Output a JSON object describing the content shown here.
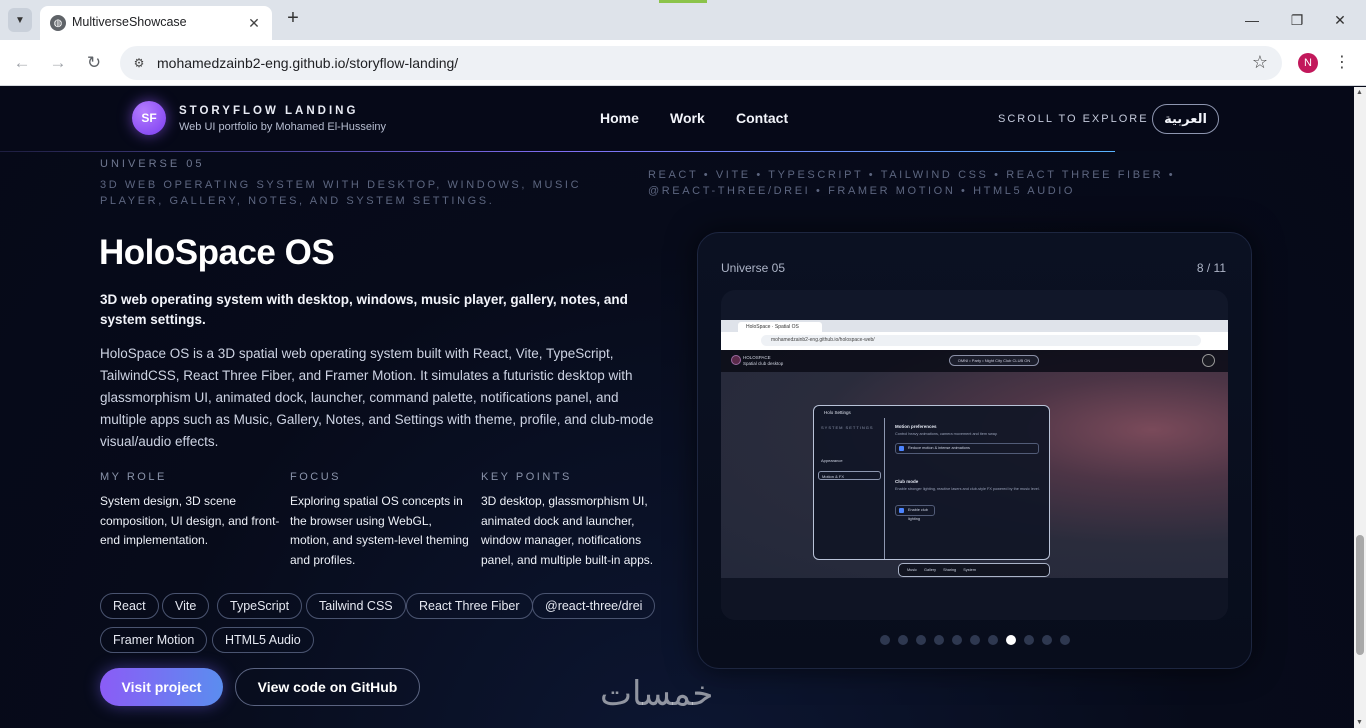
{
  "browser": {
    "tab_title": "MultiverseShowcase",
    "url": "mohamedzainb2-eng.github.io/storyflow-landing/",
    "profile_initial": "N",
    "icons": {
      "tab_list": "chevron-down-icon",
      "favicon": "globe-icon",
      "close_tab": "close-icon",
      "new_tab": "plus-icon",
      "back": "back-arrow-icon",
      "forward": "forward-arrow-icon",
      "reload": "reload-icon",
      "site_info": "site-info-icon",
      "bookmark": "star-icon",
      "menu": "kebab-menu-icon",
      "minimize": "minimize-icon",
      "maximize": "restore-icon",
      "close_window": "close-icon"
    }
  },
  "header": {
    "logo_initials": "SF",
    "brand_title": "STORYFLOW LANDING",
    "brand_subtitle": "Web UI portfolio by Mohamed El-Husseiny",
    "nav": [
      "Home",
      "Work",
      "Contact"
    ],
    "scroll_hint": "SCROLL TO EXPLORE",
    "language_button": "العربية"
  },
  "project": {
    "universe_label": "UNIVERSE 05",
    "universe_description": "3D web operating system with desktop, windows, music player, gallery, notes, and system settings.",
    "stack_line": "React • Vite • TypeScript • Tailwind CSS • React Three Fiber • @react-three/drei • Framer Motion • HTML5 Audio",
    "title": "HoloSpace OS",
    "tagline": "3D web operating system with desktop, windows, music player, gallery, notes, and system settings.",
    "description": "HoloSpace OS is a 3D spatial web operating system built with React, Vite, TypeScript, TailwindCSS, React Three Fiber, and Framer Motion. It simulates a futuristic desktop with glassmorphism UI, animated dock, launcher, command palette, notifications panel, and multiple apps such as Music, Gallery, Notes, and Settings with theme, profile, and club-mode visual/audio effects.",
    "details": [
      {
        "title": "MY ROLE",
        "text": "System design, 3D scene composition, UI design, and front-end implementation."
      },
      {
        "title": "FOCUS",
        "text": "Exploring spatial OS concepts in the browser using WebGL, motion, and system-level theming and profiles."
      },
      {
        "title": "KEY POINTS",
        "text": "3D desktop, glassmorphism UI, animated dock and launcher, window manager, notifications panel, and multiple built-in apps."
      }
    ],
    "tags": [
      "React",
      "Vite",
      "TypeScript",
      "Tailwind CSS",
      "React Three Fiber",
      "@react-three/drei",
      "Framer Motion",
      "HTML5 Audio"
    ],
    "primary_button": "Visit project",
    "secondary_button": "View code on GitHub"
  },
  "showcase": {
    "label": "Universe 05",
    "counter": "8 / 11",
    "total_slides": 11,
    "active_slide": 8,
    "screenshot": {
      "tab": "HoloSpace · Spatial OS",
      "url": "mohamedzainb2-eng.github.io/holospace-web/",
      "brand_line1": "HOLOSPACE",
      "brand_line2": "Spatial club desktop",
      "pill": "OMNI  •  Party  •  Night City Club  CLUB ON",
      "window_title": "Holo Settings",
      "sidebar_header": "SYSTEM SETTINGS",
      "sidebar_items": [
        "Appearance",
        "Motion & FX"
      ],
      "motion_title": "Motion preferences",
      "motion_text": "Control heavy animations, camera movement and item sway.",
      "motion_check": "Reduce motion & intense animations",
      "club_title": "Club mode",
      "club_text": "Enable stronger lighting, reactive lasers and club-style FX powered by the music level.",
      "club_check": "Enable club lighting",
      "dock": [
        "Music",
        "Gallery",
        "Sharing",
        "System"
      ]
    }
  },
  "watermark": "خمسات",
  "colors": {
    "page_bg": "#070b1a",
    "accent_purple": "#8b5cf6",
    "accent_blue": "#5b8def",
    "dot_active": "#ffffff",
    "dot_inactive": "#2e3850"
  }
}
